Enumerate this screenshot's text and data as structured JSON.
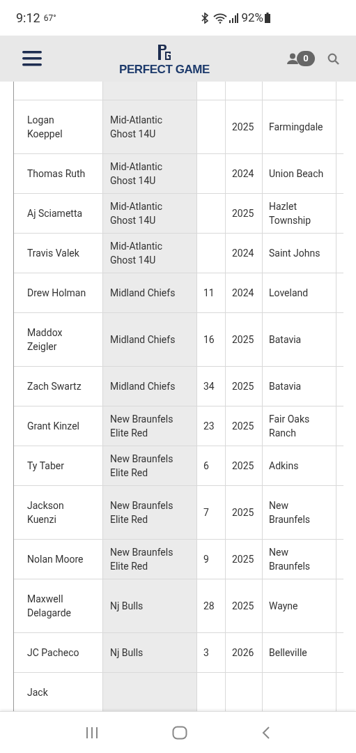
{
  "status_bar": {
    "time": "9:12",
    "temperature": "67°",
    "battery": "92%"
  },
  "header": {
    "brand": "PERFECT GAME",
    "cart_count": "0"
  },
  "rows": [
    {
      "name": "Logan Koeppel",
      "team": "Mid-Atlantic Ghost 14U",
      "number": "",
      "year": "2025",
      "city": "Farmingdale"
    },
    {
      "name": "Thomas Ruth",
      "team": "Mid-Atlantic Ghost 14U",
      "number": "",
      "year": "2024",
      "city": "Union Beach"
    },
    {
      "name": "Aj Sciametta",
      "team": "Mid-Atlantic Ghost 14U",
      "number": "",
      "year": "2025",
      "city": "Hazlet Township"
    },
    {
      "name": "Travis Valek",
      "team": "Mid-Atlantic Ghost 14U",
      "number": "",
      "year": "2024",
      "city": "Saint Johns"
    },
    {
      "name": "Drew Holman",
      "team": "Midland Chiefs",
      "number": "11",
      "year": "2024",
      "city": "Loveland"
    },
    {
      "name": "Maddox Zeigler",
      "team": "Midland Chiefs",
      "number": "16",
      "year": "2025",
      "city": "Batavia"
    },
    {
      "name": "Zach Swartz",
      "team": "Midland Chiefs",
      "number": "34",
      "year": "2025",
      "city": "Batavia"
    },
    {
      "name": "Grant Kinzel",
      "team": "New Braunfels Elite Red",
      "number": "23",
      "year": "2025",
      "city": "Fair Oaks Ranch"
    },
    {
      "name": "Ty Taber",
      "team": "New Braunfels Elite Red",
      "number": "6",
      "year": "2025",
      "city": "Adkins"
    },
    {
      "name": "Jackson Kuenzi",
      "team": "New Braunfels Elite Red",
      "number": "7",
      "year": "2025",
      "city": "New Braunfels"
    },
    {
      "name": "Nolan Moore",
      "team": "New Braunfels Elite Red",
      "number": "9",
      "year": "2025",
      "city": "New Braunfels"
    },
    {
      "name": "Maxwell Delagarde",
      "team": "Nj Bulls",
      "number": "28",
      "year": "2025",
      "city": "Wayne"
    },
    {
      "name": "JC Pacheco",
      "team": "Nj Bulls",
      "number": "3",
      "year": "2026",
      "city": "Belleville"
    },
    {
      "name": "Jack",
      "team": "",
      "number": "",
      "year": "",
      "city": ""
    }
  ]
}
